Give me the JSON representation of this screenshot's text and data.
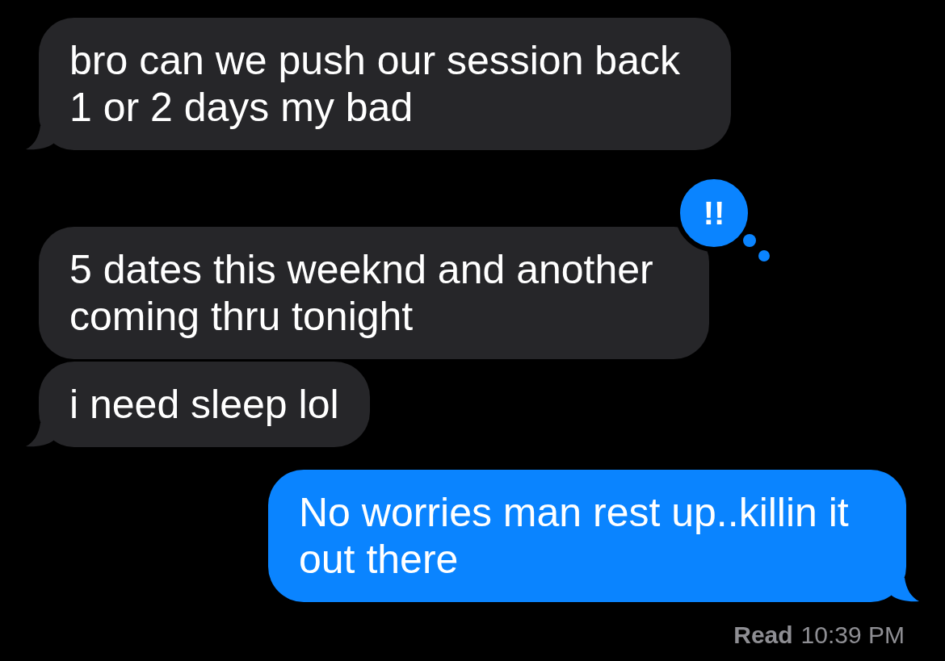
{
  "messages": [
    {
      "kind": "received",
      "text": "bro can we push our session back 1 or 2 days my bad",
      "tail": true
    },
    {
      "kind": "received",
      "text": "5 dates this weeknd and another coming thru tonight",
      "tail": false,
      "reaction": "!!"
    },
    {
      "kind": "received",
      "text": "i need sleep lol",
      "tail": true
    },
    {
      "kind": "sent",
      "text": "No worries man rest up..killin it out there",
      "tail": true
    }
  ],
  "read_receipt": {
    "label": "Read",
    "time": "10:39 PM"
  }
}
